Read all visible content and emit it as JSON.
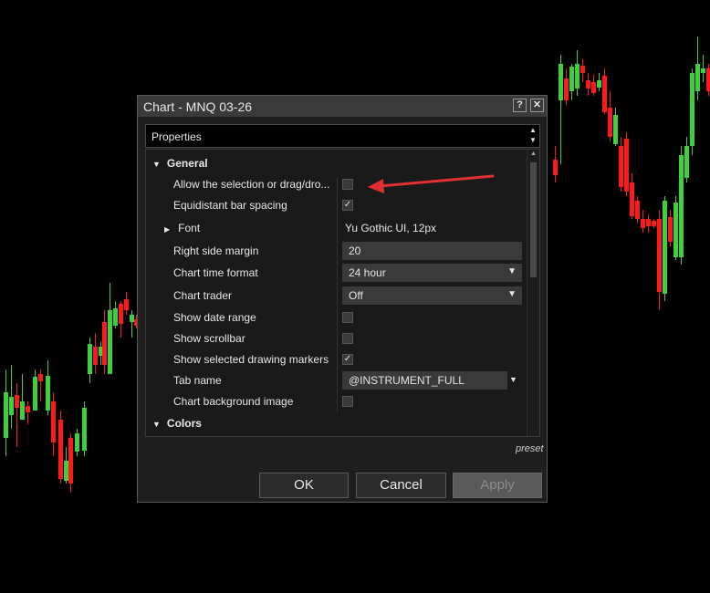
{
  "dialog": {
    "title": "Chart - MNQ 03-26",
    "help_label": "?",
    "close_label": "✕",
    "properties_label": "Properties",
    "preset_label": "preset",
    "ok_label": "OK",
    "cancel_label": "Cancel",
    "apply_label": "Apply"
  },
  "properties": {
    "general_label": "General",
    "allow_selection_label": "Allow the selection or drag/dro...",
    "allow_selection_checked": false,
    "equidistant_label": "Equidistant bar spacing",
    "equidistant_checked": true,
    "font_label": "Font",
    "font_value": "Yu Gothic UI, 12px",
    "right_margin_label": "Right side margin",
    "right_margin_value": "20",
    "time_format_label": "Chart time format",
    "time_format_value": "24 hour",
    "chart_trader_label": "Chart trader",
    "chart_trader_value": "Off",
    "date_range_label": "Show date range",
    "date_range_checked": false,
    "scrollbar_label": "Show scrollbar",
    "scrollbar_checked": false,
    "drawing_markers_label": "Show selected drawing markers",
    "drawing_markers_checked": true,
    "tab_name_label": "Tab name",
    "tab_name_value": "@INSTRUMENT_FULL",
    "bg_image_label": "Chart background image",
    "bg_image_checked": false,
    "colors_label": "Colors"
  },
  "colors": {
    "up_candle": "#3ecf3e",
    "down_candle": "#ff1a1a",
    "arrow": "#e03030"
  }
}
